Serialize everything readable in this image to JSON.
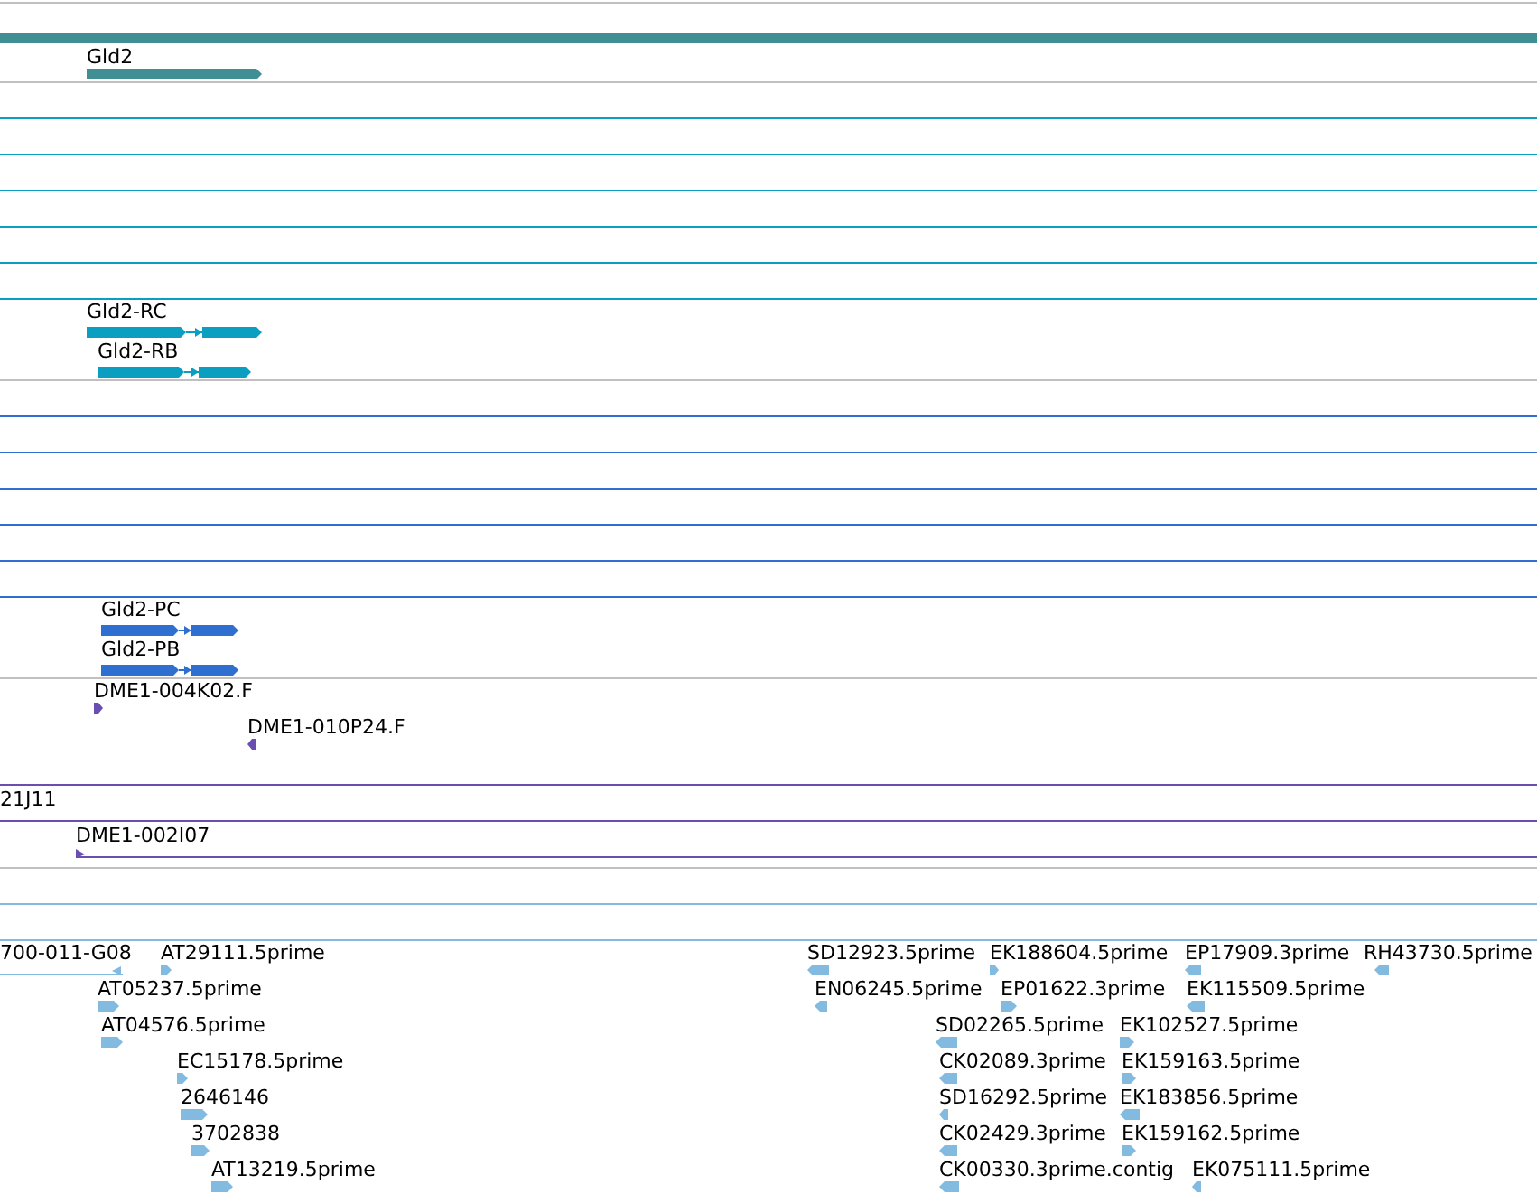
{
  "tracks": [
    {
      "color": "#3f8f94",
      "rows": [
        {
          "kind": "features",
          "features": [
            {
              "kind": "bar"
            }
          ]
        },
        {
          "kind": "features",
          "features": [
            {
              "label": "Gld2",
              "kind": "block",
              "reverse": false
            }
          ]
        }
      ]
    },
    {
      "color": "#0a9fc0",
      "rows": [
        {
          "kind": "spacer"
        },
        {
          "kind": "spacer"
        },
        {
          "kind": "spacer"
        },
        {
          "kind": "spacer"
        },
        {
          "kind": "spacer"
        },
        {
          "kind": "spacer"
        },
        {
          "kind": "features",
          "features": [
            {
              "label": "Gld2-RC",
              "kind": "exons",
              "reverse": false
            }
          ]
        },
        {
          "kind": "features",
          "features": [
            {
              "label": "Gld2-RB",
              "kind": "exons",
              "reverse": false
            }
          ]
        }
      ]
    },
    {
      "color": "#2e6fd0",
      "rows": [
        {
          "kind": "spacer"
        },
        {
          "kind": "spacer"
        },
        {
          "kind": "spacer"
        },
        {
          "kind": "spacer"
        },
        {
          "kind": "spacer"
        },
        {
          "kind": "spacer"
        },
        {
          "kind": "features",
          "features": [
            {
              "label": "Gld2-PC",
              "kind": "exons",
              "reverse": false
            }
          ]
        },
        {
          "kind": "features",
          "features": [
            {
              "label": "Gld2-PB",
              "kind": "exons",
              "reverse": false
            }
          ]
        }
      ]
    },
    {
      "color": "#6a4fb0",
      "rows": [
        {
          "kind": "features",
          "features": [
            {
              "label": "DME1-004K02.F",
              "kind": "block",
              "reverse": false
            }
          ]
        },
        {
          "kind": "features",
          "features": [
            {
              "label": "DME1-010P24.F",
              "kind": "block",
              "reverse": true
            }
          ]
        },
        {
          "kind": "features",
          "features": [
            {
              "kind": "line"
            }
          ]
        },
        {
          "kind": "features",
          "features": [
            {
              "label": "21J11",
              "kind": "line"
            }
          ]
        },
        {
          "kind": "features",
          "features": [
            {
              "label": "DME1-002I07",
              "kind": "arrow-line",
              "reverse": false
            }
          ]
        }
      ]
    },
    {
      "color": "#82bae0",
      "rows": [
        {
          "kind": "spacer"
        },
        {
          "kind": "spacer"
        },
        {
          "kind": "features",
          "features": [
            {
              "label": "700-011-G08",
              "kind": "arrow-line",
              "reverse": true
            },
            {
              "label": "AT29111.5prime",
              "kind": "block",
              "reverse": false
            },
            {
              "label": "SD12923.5prime",
              "kind": "block",
              "reverse": true
            },
            {
              "label": "EK188604.5prime",
              "kind": "block",
              "reverse": false
            },
            {
              "label": "EP17909.3prime",
              "kind": "block",
              "reverse": true
            },
            {
              "label": "RH43730.5prime",
              "kind": "block",
              "reverse": true
            }
          ]
        },
        {
          "kind": "features",
          "features": [
            {
              "label": "AT05237.5prime",
              "kind": "block",
              "reverse": false
            },
            {
              "label": "EN06245.5prime",
              "kind": "block",
              "reverse": true
            },
            {
              "label": "EP01622.3prime",
              "kind": "block",
              "reverse": false
            },
            {
              "label": "EK115509.5prime",
              "kind": "block",
              "reverse": true
            }
          ]
        },
        {
          "kind": "features",
          "features": [
            {
              "label": "AT04576.5prime",
              "kind": "block",
              "reverse": false
            },
            {
              "label": "SD02265.5prime",
              "kind": "block",
              "reverse": true
            },
            {
              "label": "EK102527.5prime",
              "kind": "block",
              "reverse": false
            }
          ]
        },
        {
          "kind": "features",
          "features": [
            {
              "label": "EC15178.5prime",
              "kind": "block",
              "reverse": false
            },
            {
              "label": "CK02089.3prime",
              "kind": "block",
              "reverse": true
            },
            {
              "label": "EK159163.5prime",
              "kind": "block",
              "reverse": false
            }
          ]
        },
        {
          "kind": "features",
          "features": [
            {
              "label": "2646146",
              "kind": "block",
              "reverse": false
            },
            {
              "label": "SD16292.5prime",
              "kind": "block",
              "reverse": true
            },
            {
              "label": "EK183856.5prime",
              "kind": "block",
              "reverse": true
            }
          ]
        },
        {
          "kind": "features",
          "features": [
            {
              "label": "3702838",
              "kind": "block",
              "reverse": false
            },
            {
              "label": "CK02429.3prime",
              "kind": "block",
              "reverse": true
            },
            {
              "label": "EK159162.5prime",
              "kind": "block",
              "reverse": false
            }
          ]
        },
        {
          "kind": "features",
          "features": [
            {
              "label": "AT13219.5prime",
              "kind": "block",
              "reverse": false
            },
            {
              "label": "CK00330.3prime.contig",
              "kind": "block",
              "reverse": true
            },
            {
              "label": "EK075111.5prime",
              "kind": "block",
              "reverse": true
            }
          ]
        }
      ]
    }
  ]
}
